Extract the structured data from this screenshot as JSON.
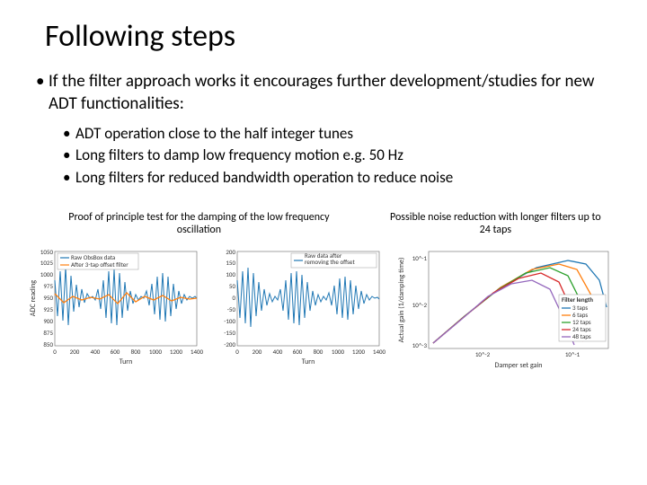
{
  "title": "Following steps",
  "bullet_main": "If the filter approach works it encourages further development/studies for new ADT functionalities:",
  "sub_bullets": [
    "ADT operation close to the half integer tunes",
    "Long filters to damp low frequency motion e.g. 50 Hz",
    "Long filters for reduced bandwidth operation to reduce noise"
  ],
  "caption_left": "Proof of principle test for the damping of the low frequency oscillation",
  "caption_right": "Possible noise reduction with longer filters up to 24 taps",
  "chart_data": [
    {
      "type": "line",
      "title": "",
      "xlabel": "Turn",
      "ylabel": "ADC reading",
      "xlim": [
        0,
        1400
      ],
      "ylim": [
        850,
        1050
      ],
      "xticks": [
        0,
        200,
        400,
        600,
        800,
        1000,
        1200,
        1400
      ],
      "yticks": [
        850,
        875,
        900,
        925,
        950,
        975,
        1000,
        1025,
        1050
      ],
      "legend": [
        "Raw ObsBox data",
        "After 3-tap offset filter"
      ],
      "series_colors": [
        "#1f77b4",
        "#ff7f0e"
      ],
      "note": "blue noisy raw signal oscillating ~850-1050 with slow beat; orange filtered trace hugging center ~950 with smaller oscillation"
    },
    {
      "type": "line",
      "title": "",
      "xlabel": "Turn",
      "ylabel": "",
      "xlim": [
        0,
        1400
      ],
      "ylim": [
        -200,
        200
      ],
      "xticks": [
        0,
        200,
        400,
        600,
        800,
        1000,
        1200,
        1400
      ],
      "yticks": [
        -200,
        -150,
        -100,
        -50,
        0,
        50,
        100,
        150,
        200
      ],
      "legend": [
        "Raw data after removing the offset"
      ],
      "series_colors": [
        "#1f77b4"
      ],
      "note": "blue noisy residual centered on 0, amplitude ~±150 decaying with beat pattern"
    },
    {
      "type": "line",
      "title": "",
      "xlabel": "Damper set gain",
      "ylabel": "Actual gain (1/damping time)",
      "xscale": "log",
      "yscale": "log",
      "xlim": [
        0.002,
        0.2
      ],
      "ylim": [
        0.0008,
        0.15
      ],
      "xticks": [
        0.01,
        0.1
      ],
      "xtick_labels": [
        "10^-2",
        "10^-1"
      ],
      "yticks": [
        0.001,
        0.01,
        0.1
      ],
      "ytick_labels": [
        "10^-3",
        "10^-2",
        "10^-1"
      ],
      "legend_title": "Filter length",
      "legend": [
        "3 taps",
        "6 taps",
        "12 taps",
        "24 taps",
        "48 taps"
      ],
      "series_colors": [
        "#1f77b4",
        "#ff7f0e",
        "#2ca02c",
        "#d62728",
        "#9467bd"
      ],
      "note": "all curves rise linearly on loglog then peak and fall; 3-tap peaks highest near gain≈0.1, longer filters peak progressively earlier/lower"
    }
  ]
}
